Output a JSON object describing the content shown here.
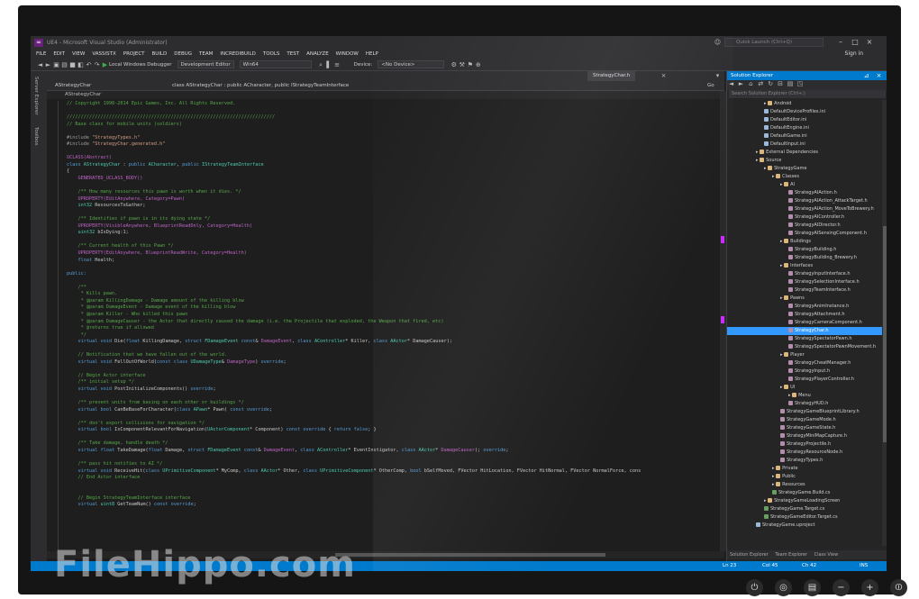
{
  "window": {
    "title": "UE4 - Microsoft Visual Studio (Administrator)",
    "quick_launch": "Quick Launch (Ctrl+Q)",
    "signin": "Sign in"
  },
  "menu": [
    "FILE",
    "EDIT",
    "VIEW",
    "VASSISTX",
    "PROJECT",
    "BUILD",
    "DEBUG",
    "TEAM",
    "INCREDIBUILD",
    "TOOLS",
    "TEST",
    "ANALYZE",
    "WINDOW",
    "HELP"
  ],
  "toolbar": {
    "debugger": "Local Windows Debugger",
    "config": "Development Editor",
    "platform": "Win64",
    "device_label": "Device:",
    "device": "<No Device>"
  },
  "side_tabs": [
    "Server Explorer",
    "Toolbox"
  ],
  "doc_tab": "StrategyChar.h",
  "nav": {
    "left": "AStrategyChar",
    "right": "class AStrategyChar : public ACharacter, public IStrategyTeamInterface",
    "right_end": "Go"
  },
  "editor_file": "AStrategyChar",
  "code": [
    [
      [
        "cm",
        "// Copyright 1998-2014 Epic Games, Inc. All Rights Reserved."
      ]
    ],
    [],
    [
      [
        "cm",
        "//////////////////////////////////////////////////////////////////////////"
      ]
    ],
    [
      [
        "cm",
        "// Base class for mobile units (soldiers)"
      ]
    ],
    [],
    [
      [
        "pp",
        "#include "
      ],
      [
        "str",
        "\"StrategyTypes.h\""
      ]
    ],
    [
      [
        "pp",
        "#include "
      ],
      [
        "str",
        "\"StrategyChar.generated.h\""
      ]
    ],
    [],
    [
      [
        "mac",
        "UCLASS(Abstract)"
      ]
    ],
    [
      [
        "kw",
        "class "
      ],
      [
        "ty",
        "AStrategyChar"
      ],
      [
        "pl",
        " : "
      ],
      [
        "kw",
        "public "
      ],
      [
        "ty",
        "ACharacter"
      ],
      [
        "pl",
        ", "
      ],
      [
        "kw",
        "public "
      ],
      [
        "ty",
        "IStrategyTeamInterface"
      ]
    ],
    [
      [
        "pl",
        "{"
      ]
    ],
    [
      [
        "mac",
        "    GENERATED_UCLASS_BODY()"
      ]
    ],
    [],
    [
      [
        "cm",
        "    /** How many resources this pawn is worth when it dies. */"
      ]
    ],
    [
      [
        "mac",
        "    UPROPERTY(EditAnywhere, Category=Pawn)"
      ]
    ],
    [
      [
        "ty",
        "    int32"
      ],
      [
        "pl",
        " ResourcesToGather;"
      ]
    ],
    [],
    [
      [
        "cm",
        "    /** Identifies if pawn is in its dying state */"
      ]
    ],
    [
      [
        "mac",
        "    UPROPERTY(VisibleAnywhere, BlueprintReadOnly, Category=Health)"
      ]
    ],
    [
      [
        "ty",
        "    uint32"
      ],
      [
        "pl",
        " bIsDying:1;"
      ]
    ],
    [],
    [
      [
        "cm",
        "    /** Current health of this Pawn */"
      ]
    ],
    [
      [
        "mac",
        "    UPROPERTY(EditAnywhere, BlueprintReadWrite, Category=Health)"
      ]
    ],
    [
      [
        "kw",
        "    float"
      ],
      [
        "pl",
        " Health;"
      ]
    ],
    [],
    [
      [
        "kw",
        "public:"
      ]
    ],
    [],
    [
      [
        "cm",
        "    /**"
      ]
    ],
    [
      [
        "cm",
        "     * Kills pawn."
      ]
    ],
    [
      [
        "cm",
        "     * @param KillingDamage - Damage amount of the killing blow"
      ]
    ],
    [
      [
        "cm",
        "     * @param DamageEvent - Damage event of the killing blow"
      ]
    ],
    [
      [
        "cm",
        "     * @param Killer - Who killed this pawn"
      ]
    ],
    [
      [
        "cm",
        "     * @param DamageCauser - the Actor that directly caused the damage (i.e. the Projectile that exploded, the Weapon that fired, etc)"
      ]
    ],
    [
      [
        "cm",
        "     * @returns true if allowed"
      ]
    ],
    [
      [
        "cm",
        "     */"
      ]
    ],
    [
      [
        "kw",
        "    virtual void"
      ],
      [
        "pl",
        " Die("
      ],
      [
        "kw",
        "float"
      ],
      [
        "pl",
        " KillingDamage, "
      ],
      [
        "kw",
        "struct "
      ],
      [
        "ty",
        "FDamageEvent"
      ],
      [
        "kw",
        " const"
      ],
      [
        "pl",
        "& "
      ],
      [
        "mac",
        "DamageEvent"
      ],
      [
        "pl",
        ", "
      ],
      [
        "kw",
        "class "
      ],
      [
        "ty",
        "AController"
      ],
      [
        "pl",
        "* Killer, "
      ],
      [
        "kw",
        "class "
      ],
      [
        "ty",
        "AActor"
      ],
      [
        "pl",
        "* DamageCauser);"
      ]
    ],
    [],
    [
      [
        "cm",
        "    // Notification that we have fallen out of the world."
      ]
    ],
    [
      [
        "kw",
        "    virtual void"
      ],
      [
        "pl",
        " FellOutOfWorld("
      ],
      [
        "kw",
        "const class "
      ],
      [
        "ty",
        "UDamageType"
      ],
      [
        "pl",
        "& "
      ],
      [
        "mac",
        "DamageType"
      ],
      [
        "pl",
        ") "
      ],
      [
        "kw",
        "override"
      ],
      [
        "pl",
        ";"
      ]
    ],
    [],
    [
      [
        "cm",
        "    // Begin Actor interface"
      ]
    ],
    [
      [
        "cm",
        "    /** initial setup */"
      ]
    ],
    [
      [
        "kw",
        "    virtual void"
      ],
      [
        "pl",
        " PostInitializeComponents() "
      ],
      [
        "kw",
        "override"
      ],
      [
        "pl",
        ";"
      ]
    ],
    [],
    [
      [
        "cm",
        "    /** prevent units from basing on each other or buildings */"
      ]
    ],
    [
      [
        "kw",
        "    virtual bool"
      ],
      [
        "pl",
        " CanBeBaseForCharacter("
      ],
      [
        "kw",
        "class "
      ],
      [
        "ty",
        "APawn"
      ],
      [
        "pl",
        "* Pawn) "
      ],
      [
        "kw",
        "const override"
      ],
      [
        "pl",
        ";"
      ]
    ],
    [],
    [
      [
        "cm",
        "    /** don't export collisions for navigation */"
      ]
    ],
    [
      [
        "kw",
        "    virtual bool"
      ],
      [
        "pl",
        " IsComponentRelevantForNavigation("
      ],
      [
        "ty",
        "UActorComponent"
      ],
      [
        "pl",
        "* Component) "
      ],
      [
        "kw",
        "const override"
      ],
      [
        "pl",
        " { "
      ],
      [
        "kw",
        "return false"
      ],
      [
        "pl",
        "; }"
      ]
    ],
    [],
    [
      [
        "cm",
        "    /** Take damage, handle death */"
      ]
    ],
    [
      [
        "kw",
        "    virtual float"
      ],
      [
        "pl",
        " TakeDamage("
      ],
      [
        "kw",
        "float"
      ],
      [
        "pl",
        " Damage, "
      ],
      [
        "kw",
        "struct "
      ],
      [
        "ty",
        "FDamageEvent"
      ],
      [
        "kw",
        " const"
      ],
      [
        "pl",
        "& "
      ],
      [
        "mac",
        "DamageEvent"
      ],
      [
        "pl",
        ", "
      ],
      [
        "kw",
        "class "
      ],
      [
        "ty",
        "AController"
      ],
      [
        "pl",
        "* EventInstigator, "
      ],
      [
        "kw",
        "class "
      ],
      [
        "ty",
        "AActor"
      ],
      [
        "pl",
        "* "
      ],
      [
        "mac",
        "DamageCauser"
      ],
      [
        "pl",
        "); "
      ],
      [
        "kw",
        "override"
      ],
      [
        "pl",
        ";"
      ]
    ],
    [],
    [
      [
        "cm",
        "    /** pass hit notifies to AI */"
      ]
    ],
    [
      [
        "kw",
        "    virtual void"
      ],
      [
        "pl",
        " ReceiveHit("
      ],
      [
        "kw",
        "class "
      ],
      [
        "ty",
        "UPrimitiveComponent"
      ],
      [
        "pl",
        "* MyComp, "
      ],
      [
        "kw",
        "class "
      ],
      [
        "ty",
        "AActor"
      ],
      [
        "pl",
        "* Other, "
      ],
      [
        "kw",
        "class "
      ],
      [
        "ty",
        "UPrimitiveComponent"
      ],
      [
        "pl",
        "* OtherComp, "
      ],
      [
        "kw",
        "bool"
      ],
      [
        "pl",
        " bSelfMoved, FVector HitLocation, FVector HitNormal, FVector NormalForce, cons"
      ]
    ],
    [
      [
        "cm",
        "    // End Actor interface"
      ]
    ],
    [],
    [],
    [
      [
        "cm",
        "    // Begin StrategyTeamInterface interface"
      ]
    ],
    [
      [
        "kw",
        "    virtual"
      ],
      [
        "ty",
        " uint8"
      ],
      [
        "pl",
        " GetTeamNum() "
      ],
      [
        "kw",
        "const override"
      ],
      [
        "pl",
        ";"
      ]
    ]
  ],
  "solution_explorer": {
    "title": "Solution Explorer",
    "search": "Search Solution Explorer (Ctrl+;)",
    "items": [
      {
        "label": "Android",
        "indent": 5,
        "kind": "folder",
        "sel": false
      },
      {
        "label": "DefaultDeviceProfiles.ini",
        "indent": 5,
        "kind": "file",
        "sel": false
      },
      {
        "label": "DefaultEditor.ini",
        "indent": 5,
        "kind": "file",
        "sel": false
      },
      {
        "label": "DefaultEngine.ini",
        "indent": 5,
        "kind": "file",
        "sel": false
      },
      {
        "label": "DefaultGame.ini",
        "indent": 5,
        "kind": "file",
        "sel": false
      },
      {
        "label": "DefaultInput.ini",
        "indent": 5,
        "kind": "file",
        "sel": false
      },
      {
        "label": "External Dependencies",
        "indent": 4,
        "kind": "folder",
        "sel": false
      },
      {
        "label": "Source",
        "indent": 4,
        "kind": "folder",
        "sel": false
      },
      {
        "label": "StrategyGame",
        "indent": 5,
        "kind": "folder",
        "sel": false
      },
      {
        "label": "Classes",
        "indent": 6,
        "kind": "folder",
        "sel": false
      },
      {
        "label": "AI",
        "indent": 7,
        "kind": "folder",
        "sel": false
      },
      {
        "label": "StrategyAIAction.h",
        "indent": 8,
        "kind": "h",
        "sel": false
      },
      {
        "label": "StrategyAIAction_AttackTarget.h",
        "indent": 8,
        "kind": "h",
        "sel": false
      },
      {
        "label": "StrategyAIAction_MoveToBrewery.h",
        "indent": 8,
        "kind": "h",
        "sel": false
      },
      {
        "label": "StrategyAIController.h",
        "indent": 8,
        "kind": "h",
        "sel": false
      },
      {
        "label": "StrategyAIDirector.h",
        "indent": 8,
        "kind": "h",
        "sel": false
      },
      {
        "label": "StrategyAISensingComponent.h",
        "indent": 8,
        "kind": "h",
        "sel": false
      },
      {
        "label": "Buildings",
        "indent": 7,
        "kind": "folder",
        "sel": false
      },
      {
        "label": "StrategyBuilding.h",
        "indent": 8,
        "kind": "h",
        "sel": false
      },
      {
        "label": "StrategyBuilding_Brewery.h",
        "indent": 8,
        "kind": "h",
        "sel": false
      },
      {
        "label": "Interfaces",
        "indent": 7,
        "kind": "folder",
        "sel": false
      },
      {
        "label": "StrategyInputInterface.h",
        "indent": 8,
        "kind": "h",
        "sel": false
      },
      {
        "label": "StrategySelectionInterface.h",
        "indent": 8,
        "kind": "h",
        "sel": false
      },
      {
        "label": "StrategyTeamInterface.h",
        "indent": 8,
        "kind": "h",
        "sel": false
      },
      {
        "label": "Pawns",
        "indent": 7,
        "kind": "folder",
        "sel": false
      },
      {
        "label": "StrategyAnimInstance.h",
        "indent": 8,
        "kind": "h",
        "sel": false
      },
      {
        "label": "StrategyAttachment.h",
        "indent": 8,
        "kind": "h",
        "sel": false
      },
      {
        "label": "StrategyCameraComponent.h",
        "indent": 8,
        "kind": "h",
        "sel": false
      },
      {
        "label": "StrategyChar.h",
        "indent": 8,
        "kind": "h",
        "sel": true
      },
      {
        "label": "StrategySpectatorPawn.h",
        "indent": 8,
        "kind": "h",
        "sel": false
      },
      {
        "label": "StrategySpectatorPawnMovement.h",
        "indent": 8,
        "kind": "h",
        "sel": false
      },
      {
        "label": "Player",
        "indent": 7,
        "kind": "folder",
        "sel": false
      },
      {
        "label": "StrategyCheatManager.h",
        "indent": 8,
        "kind": "h",
        "sel": false
      },
      {
        "label": "StrategyInput.h",
        "indent": 8,
        "kind": "h",
        "sel": false
      },
      {
        "label": "StrategyPlayerController.h",
        "indent": 8,
        "kind": "h",
        "sel": false
      },
      {
        "label": "UI",
        "indent": 7,
        "kind": "folder",
        "sel": false
      },
      {
        "label": "Menu",
        "indent": 8,
        "kind": "folder",
        "sel": false
      },
      {
        "label": "StrategyHUD.h",
        "indent": 8,
        "kind": "h",
        "sel": false
      },
      {
        "label": "StrategyGameBlueprintLibrary.h",
        "indent": 7,
        "kind": "h",
        "sel": false
      },
      {
        "label": "StrategyGameMode.h",
        "indent": 7,
        "kind": "h",
        "sel": false
      },
      {
        "label": "StrategyGameState.h",
        "indent": 7,
        "kind": "h",
        "sel": false
      },
      {
        "label": "StrategyMiniMapCapture.h",
        "indent": 7,
        "kind": "h",
        "sel": false
      },
      {
        "label": "StrategyProjectile.h",
        "indent": 7,
        "kind": "h",
        "sel": false
      },
      {
        "label": "StrategyResourceNode.h",
        "indent": 7,
        "kind": "h",
        "sel": false
      },
      {
        "label": "StrategyTypes.h",
        "indent": 7,
        "kind": "h",
        "sel": false
      },
      {
        "label": "Private",
        "indent": 6,
        "kind": "folder",
        "sel": false
      },
      {
        "label": "Public",
        "indent": 6,
        "kind": "folder",
        "sel": false
      },
      {
        "label": "Resources",
        "indent": 6,
        "kind": "folder",
        "sel": false
      },
      {
        "label": "StrategyGame.Build.cs",
        "indent": 6,
        "kind": "cs",
        "sel": false
      },
      {
        "label": "StrategyGameLoadingScreen",
        "indent": 5,
        "kind": "folder",
        "sel": false
      },
      {
        "label": "StrategyGame.Target.cs",
        "indent": 5,
        "kind": "cs",
        "sel": false
      },
      {
        "label": "StrategyGameEditor.Target.cs",
        "indent": 5,
        "kind": "cs",
        "sel": false
      },
      {
        "label": "StrategyGame.uproject",
        "indent": 4,
        "kind": "file",
        "sel": false
      }
    ],
    "tabs": [
      "Solution Explorer",
      "Team Explorer",
      "Class View"
    ]
  },
  "status": {
    "ln": "Ln 23",
    "col": "Col 45",
    "ch": "Ch 42",
    "mode": "INS"
  },
  "watermark": "FileHippo.com",
  "bezel_icons": [
    "power-icon",
    "settings-icon",
    "menu-icon",
    "minus-icon",
    "plus-icon",
    "input-icon"
  ]
}
